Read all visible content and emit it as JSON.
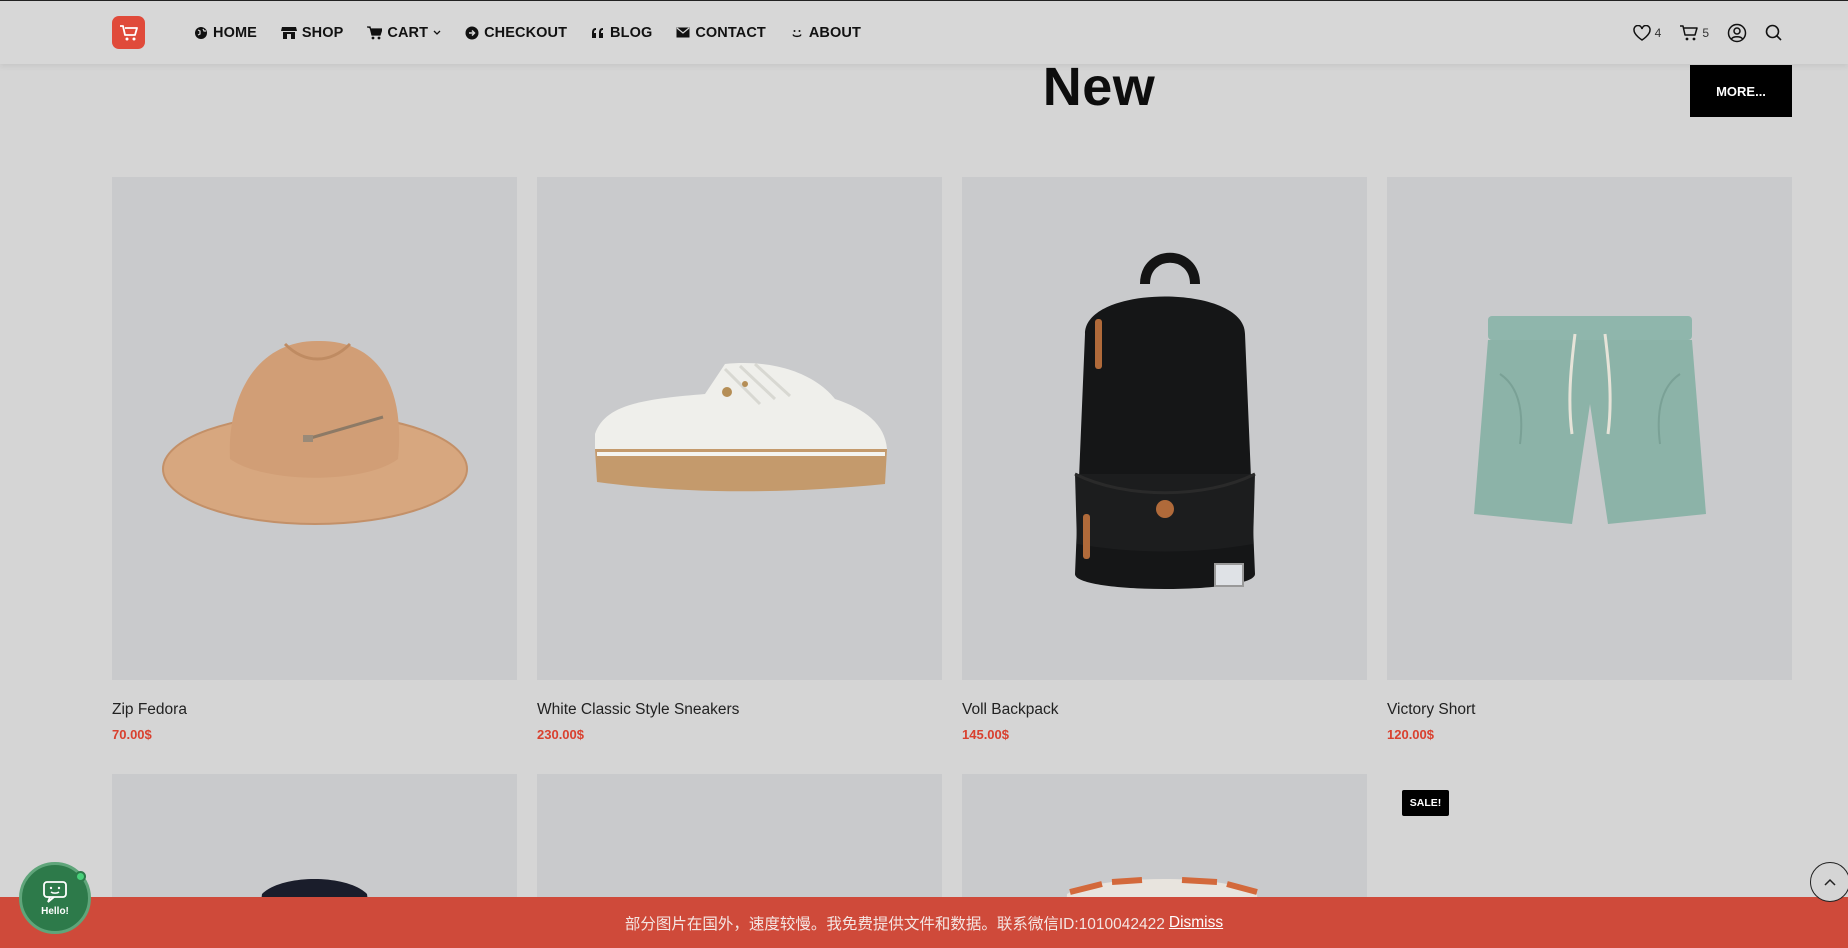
{
  "header": {
    "nav": [
      {
        "label": "HOME",
        "icon": "globe-icon"
      },
      {
        "label": "SHOP",
        "icon": "store-icon"
      },
      {
        "label": "CART",
        "icon": "cart-icon",
        "has_dropdown": true
      },
      {
        "label": "CHECKOUT",
        "icon": "arrow-circle-icon"
      },
      {
        "label": "BLOG",
        "icon": "quote-icon"
      },
      {
        "label": "CONTACT",
        "icon": "envelope-icon"
      },
      {
        "label": "ABOUT",
        "icon": "smile-icon"
      }
    ],
    "wishlist_count": "4",
    "cart_count": "5"
  },
  "section": {
    "title": "New",
    "more_label": "MORE..."
  },
  "products": [
    {
      "name": "Zip Fedora",
      "price": "70.00$",
      "image": "hat"
    },
    {
      "name": "White Classic Style Sneakers",
      "price": "230.00$",
      "image": "sneaker"
    },
    {
      "name": "Voll Backpack",
      "price": "145.00$",
      "image": "backpack"
    },
    {
      "name": "Victory Short",
      "price": "120.00$",
      "image": "shorts"
    }
  ],
  "sale_badge": "SALE!",
  "chat": {
    "label": "Hello!"
  },
  "notice": {
    "text": "部分图片在国外，速度较慢。我免费提供文件和数据。联系微信ID:1010042422",
    "dismiss": "Dismiss"
  },
  "colors": {
    "accent": "#d9402e",
    "notice_bg": "#cf4a3a",
    "chat_bg": "#2d7a4a"
  }
}
